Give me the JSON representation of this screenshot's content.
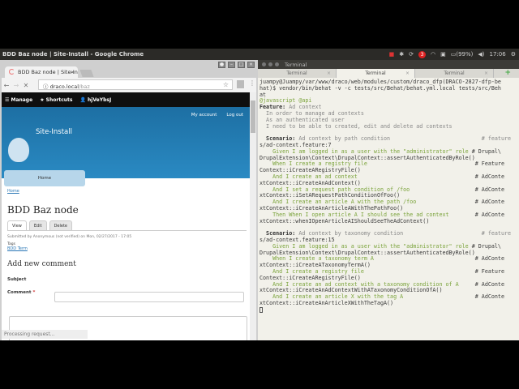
{
  "topbar": {
    "title": "BDD Baz node | Site-Install - Google Chrome",
    "notif_count": "3",
    "battery": "(99%)",
    "time": "17:06"
  },
  "chrome": {
    "tab_title": "BDD Baz node | Site-Install",
    "url_host": "draco.local",
    "url_path": "/baz",
    "status": "Processing request..."
  },
  "admin": {
    "manage": "Manage",
    "shortcuts": "Shortcuts",
    "user": "hjVeYbsJ"
  },
  "site": {
    "my_account": "My account",
    "log_out": "Log out",
    "name": "Site-Install",
    "home": "Home"
  },
  "node": {
    "breadcrumb": "Home",
    "title": "BDD Baz node",
    "tabs": [
      "View",
      "Edit",
      "Delete"
    ],
    "submitted": "Submitted by Anonymous (not verified) on Mon, 02/27/2017 - 17:05",
    "tags_label": "Tags",
    "tag": "BDD Term",
    "comment_heading": "Add new comment",
    "subject_label": "Subject",
    "comment_label": "Comment",
    "required": "*"
  },
  "terminal": {
    "window_title": "Terminal",
    "tabs": [
      "Terminal",
      "Terminal",
      "Terminal"
    ],
    "lines": [
      {
        "t": "juampy@Juampy/var/www/draco/web/modules/custom/draco_dfp(DRACO-2827-dfp-be",
        "k": "n"
      },
      {
        "t": "hat)$ vendor/bin/behat -v -c tests/src/Behat/behat.yml.local tests/src/Beh",
        "k": "n"
      },
      {
        "t": "at",
        "k": "n"
      },
      {
        "t": "@javascript @api",
        "k": "g"
      },
      {
        "t": "Feature: Ad context",
        "k": "f"
      },
      {
        "t": "  In order to manage ad contexts",
        "k": "c"
      },
      {
        "t": "  As an authenticated user",
        "k": "c"
      },
      {
        "t": "  I need to be able to created, edit and delete ad contexts",
        "k": "c"
      },
      {
        "t": "",
        "k": "n"
      },
      {
        "t": "  Scenario: Ad context by path condition                            # feature",
        "k": "s"
      },
      {
        "t": "s/ad-context.feature:7",
        "k": "n"
      },
      {
        "t": "    Given I am logged in as a user with the \"administrator\" role # Drupal\\",
        "k": "g"
      },
      {
        "t": "DrupalExtension\\Context\\DrupalContext::assertAuthenticatedByRole()",
        "k": "n"
      },
      {
        "t": "    When I create a registry file                                 # Feature",
        "k": "g"
      },
      {
        "t": "Context::iCreateARegistryFile()",
        "k": "n"
      },
      {
        "t": "    And I create an ad context                                    # AdConte",
        "k": "g"
      },
      {
        "t": "xtContext::iCreateAnAdContext()",
        "k": "n"
      },
      {
        "t": "    And I set a request path condition of /foo                    # AdConte",
        "k": "g"
      },
      {
        "t": "xtContext::iSetARequestPathConditionOfFoo()",
        "k": "n"
      },
      {
        "t": "    And I create an article A with the path /foo                  # AdConte",
        "k": "g"
      },
      {
        "t": "xtContext::iCreateAnArticleAWithThePathFoo()",
        "k": "n"
      },
      {
        "t": "    Then When I open article A I should see the ad context        # AdConte",
        "k": "g"
      },
      {
        "t": "xtContext::whenIOpenArticleAIShouldSeeTheAdContext()",
        "k": "n"
      },
      {
        "t": "",
        "k": "n"
      },
      {
        "t": "  Scenario: Ad context by taxonomy condition                        # feature",
        "k": "s"
      },
      {
        "t": "s/ad-context.feature:15",
        "k": "n"
      },
      {
        "t": "    Given I am logged in as a user with the \"administrator\" role # Drupal\\",
        "k": "g"
      },
      {
        "t": "DrupalExtension\\Context\\DrupalContext::assertAuthenticatedByRole()",
        "k": "n"
      },
      {
        "t": "    When I create a taxonomy term A                               # AdConte",
        "k": "g"
      },
      {
        "t": "xtContext::iCreateATaxonomyTermA()",
        "k": "n"
      },
      {
        "t": "    And I create a registry file                                  # Feature",
        "k": "g"
      },
      {
        "t": "Context::iCreateARegistryFile()",
        "k": "n"
      },
      {
        "t": "    And I create an ad context with a taxonomy condition of A     # AdConte",
        "k": "g"
      },
      {
        "t": "xtContext::iCreateAnAdContextWithATaxonomyConditionOfA()",
        "k": "n"
      },
      {
        "t": "    And I create an article X with the tag A                      # AdConte",
        "k": "g"
      },
      {
        "t": "xtContext::iCreateAnArticleXWithTheTagA()",
        "k": "n"
      }
    ]
  }
}
